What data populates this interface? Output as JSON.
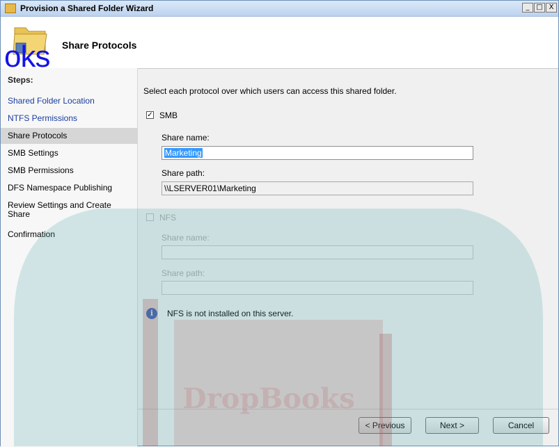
{
  "window": {
    "title": "Provision a Shared Folder Wizard",
    "controls": [
      "_",
      "□",
      "X"
    ]
  },
  "header": {
    "title": "Share Protocols"
  },
  "watermark": {
    "word": "oks",
    "brand": "DropBooks"
  },
  "steps": {
    "heading": "Steps:",
    "items": [
      {
        "label": "Shared Folder Location",
        "state": "done"
      },
      {
        "label": "NTFS Permissions",
        "state": "done"
      },
      {
        "label": "Share Protocols",
        "state": "current"
      },
      {
        "label": "SMB Settings",
        "state": "pending"
      },
      {
        "label": "SMB Permissions",
        "state": "pending"
      },
      {
        "label": "DFS Namespace Publishing",
        "state": "pending"
      },
      {
        "label": "Review Settings and Create Share",
        "state": "pending"
      },
      {
        "label": "Confirmation",
        "state": "pending"
      }
    ]
  },
  "main": {
    "instruction": "Select each protocol over which users can access this shared folder.",
    "smb": {
      "label": "SMB",
      "checked": true,
      "share_name_label": "Share name:",
      "share_name_value": "Marketing",
      "share_path_label": "Share path:",
      "share_path_value": "\\\\LSERVER01\\Marketing"
    },
    "nfs": {
      "label": "NFS",
      "checked": false,
      "share_name_label": "Share name:",
      "share_path_label": "Share path:"
    },
    "info": "NFS is not installed on this server."
  },
  "footer": {
    "previous": "< Previous",
    "next": "Next >",
    "cancel": "Cancel"
  },
  "colors": {
    "link": "#1a3e9e",
    "active_step_bg": "#d6d6d6",
    "watermark_teal": "#4aa5a9",
    "watermark_word": "#1414e8"
  }
}
